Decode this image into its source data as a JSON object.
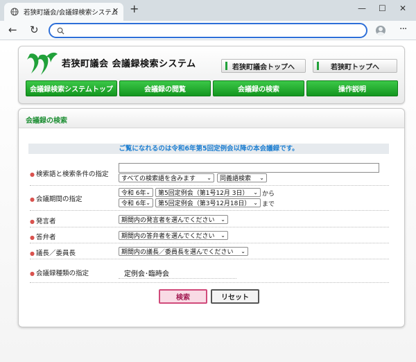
{
  "browser": {
    "tab_title": "若狭町議会/会議録検索システム",
    "tab_close": "✕",
    "new_tab": "+",
    "minimize": "—",
    "maximize": "☐",
    "close": "✕",
    "back": "←",
    "reload": "↻",
    "menu": "···",
    "address_value": ""
  },
  "header": {
    "site_title": "若狭町議会 会議録検索システム",
    "links": [
      "若狭町議会トップへ",
      "若狭町トップへ"
    ],
    "nav_tabs": [
      "会議録検索システムトップ",
      "会議録の閲覧",
      "会議録の検索",
      "操作説明"
    ]
  },
  "main": {
    "section_title": "会議録の検索",
    "notice": "ご覧になれるのは令和6年第5回定例会以降の本会議録です。",
    "keyword": {
      "label": "検索語と検索条件の指定",
      "value": "",
      "mode": "すべての検索語を含みます",
      "synonym": "同義語検索"
    },
    "period": {
      "label": "会議期間の指定",
      "from_year": "令和 6年",
      "from_session": "第5回定例会（第1号12月 3日）",
      "from_suffix": "から",
      "to_year": "令和 6年",
      "to_session": "第5回定例会（第3号12月18日）",
      "to_suffix": "まで"
    },
    "speaker": {
      "label": "発言者",
      "value": "期間内の発言者を選んでください"
    },
    "answerer": {
      "label": "答弁者",
      "value": "期間内の答弁者を選んでください"
    },
    "chair": {
      "label": "議長／委員長",
      "value": "期間内の議長／委員長を選んでください"
    },
    "type": {
      "label": "会議録種類の指定",
      "value": "定例会･臨時会"
    },
    "buttons": {
      "search": "検索",
      "reset": "リセット"
    }
  },
  "colors": {
    "brand_green": "#13961f",
    "accent_blue": "#2d6fd8",
    "notice_blue": "#1c7ed1"
  }
}
